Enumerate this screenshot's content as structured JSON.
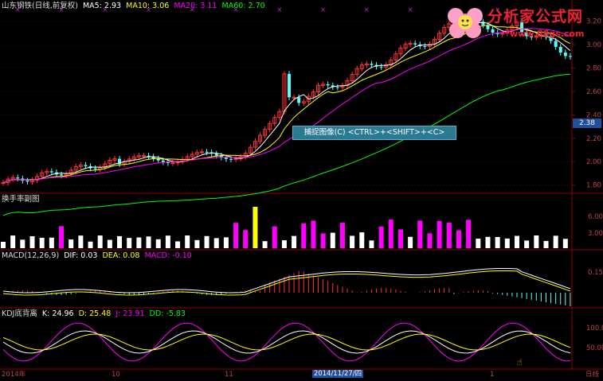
{
  "price_header": {
    "title": "山东钢铁(日线,前复权)",
    "ma5": "MA5: 2.93",
    "ma10": "MA10: 3.06",
    "ma20": "MA20: 3.11",
    "ma60": "MA60: 2.70"
  },
  "volume_header": {
    "title": "换手率副图"
  },
  "macd_header": {
    "title": "MACD(12,26,9)",
    "dif": "DIF: 0.03",
    "dea": "DEA: 0.08",
    "macd": "MACD: -0.10"
  },
  "kdj_header": {
    "title": "KDJ底背离",
    "k": "K: 24.96",
    "d": "D: 25.48",
    "j": "J: 23.91",
    "dd": "DD: -5.83"
  },
  "price_axis": [
    "3.20",
    "3.00",
    "2.80",
    "2.60",
    "2.40",
    "2.20",
    "2.00",
    "1.80"
  ],
  "current_price_tag": "2.38",
  "volume_axis": [
    "6.00",
    "3.00"
  ],
  "macd_axis": [
    "0.15"
  ],
  "kdj_axis": [
    "100.0",
    "50.00"
  ],
  "capture_hint": "捕捉图像(C)    <CTRL>+<SHIFT>+<C>",
  "date_labels": [
    "2014年",
    "10",
    "11",
    "2014/11/27/四",
    "1",
    "日线"
  ],
  "logo": {
    "title": "分析家公式网",
    "url": "www.88gs.com"
  },
  "colors": {
    "up": "#ff3232",
    "down": "#54ffff",
    "ma5": "#ffffff",
    "ma10": "#ffff00",
    "ma20": "#ff00ff",
    "ma60": "#00ff00",
    "dea": "#ffff00",
    "macd": "#ff00ff",
    "dd": "#00ff00",
    "grid": "#8b0000"
  }
}
